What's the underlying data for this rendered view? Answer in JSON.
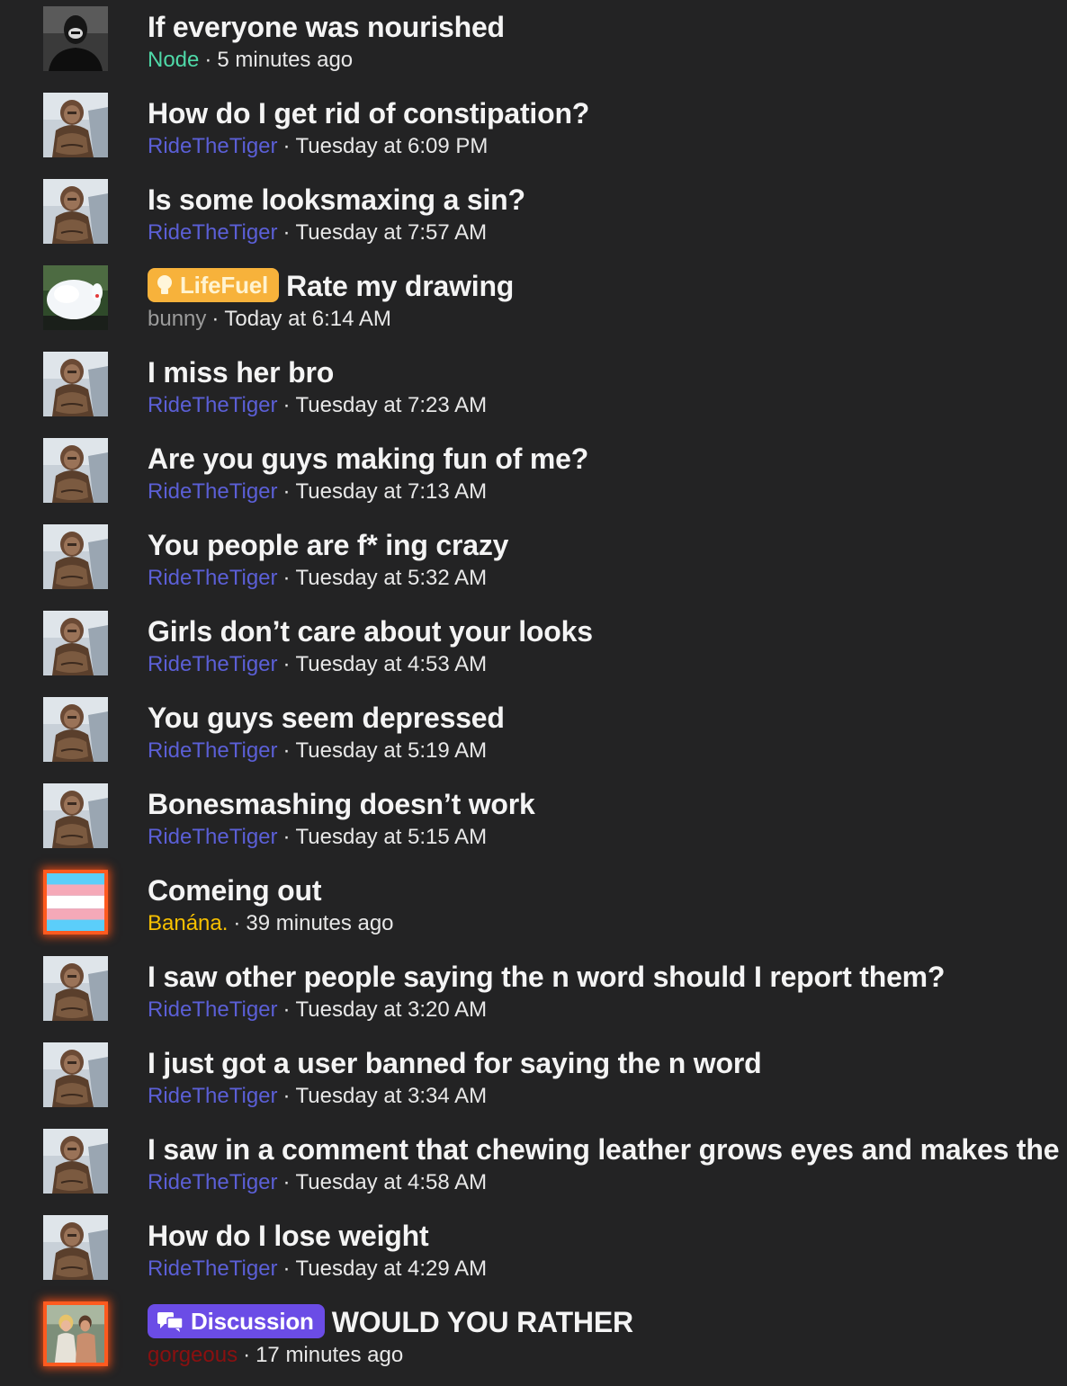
{
  "threads": [
    {
      "title": "If everyone was nourished",
      "author": "Node",
      "time": "5 minutes ago",
      "avatar": "man-portrait"
    },
    {
      "title": "How do I get rid of constipation?",
      "author": "RideTheTiger",
      "time": "Tuesday at 6:09 PM",
      "avatar": "caveman"
    },
    {
      "title": "Is some looksmaxing a sin?",
      "author": "RideTheTiger",
      "time": "Tuesday at 7:57 AM",
      "avatar": "caveman"
    },
    {
      "prefix": "LifeFuel",
      "title": "Rate my drawing",
      "author": "bunny",
      "time": "Today at 6:14 AM",
      "avatar": "fluffy-bunny"
    },
    {
      "title": "I miss her bro",
      "author": "RideTheTiger",
      "time": "Tuesday at 7:23 AM",
      "avatar": "caveman"
    },
    {
      "title": "Are you guys making fun of me?",
      "author": "RideTheTiger",
      "time": "Tuesday at 7:13 AM",
      "avatar": "caveman"
    },
    {
      "title": "You people are f* ing crazy",
      "author": "RideTheTiger",
      "time": "Tuesday at 5:32 AM",
      "avatar": "caveman"
    },
    {
      "title": "Girls don’t care about your looks",
      "author": "RideTheTiger",
      "time": "Tuesday at 4:53 AM",
      "avatar": "caveman"
    },
    {
      "title": "You guys seem depressed",
      "author": "RideTheTiger",
      "time": "Tuesday at 5:19 AM",
      "avatar": "caveman"
    },
    {
      "title": "Bonesmashing doesn’t work",
      "author": "RideTheTiger",
      "time": "Tuesday at 5:15 AM",
      "avatar": "caveman"
    },
    {
      "title": "Comeing out",
      "author": "Banána.",
      "time": "39 minutes ago",
      "avatar": "trans-flag"
    },
    {
      "title": "I saw other people saying the n word should I report them?",
      "author": "RideTheTiger",
      "time": "Tuesday at 3:20 AM",
      "avatar": "caveman"
    },
    {
      "title": "I just got a user banned for saying the n word",
      "author": "RideTheTiger",
      "time": "Tuesday at 3:34 AM",
      "avatar": "caveman"
    },
    {
      "title": "I saw in a comment that chewing leather grows eyes and makes the",
      "author": "RideTheTiger",
      "time": "Tuesday at 4:58 AM",
      "avatar": "caveman"
    },
    {
      "title": "How do I lose weight",
      "author": "RideTheTiger",
      "time": "Tuesday at 4:29 AM",
      "avatar": "caveman"
    },
    {
      "prefix": "Discussion",
      "title": "WOULD YOU RATHER",
      "author": "gorgeous",
      "time": "17 minutes ago",
      "avatar": "couple-photo"
    }
  ],
  "separator": "·",
  "colors": {
    "background": "#232324",
    "username_blue": "#5b5fd6",
    "username_teal": "#4fd9a8",
    "username_gray": "#9b9b9b",
    "username_gold": "#f7c000",
    "username_red": "#8a1010",
    "prefix_lifefuel": "#f7b23b",
    "prefix_discussion": "#6b4ce6",
    "avatar_glow": "#ff5a1f"
  }
}
